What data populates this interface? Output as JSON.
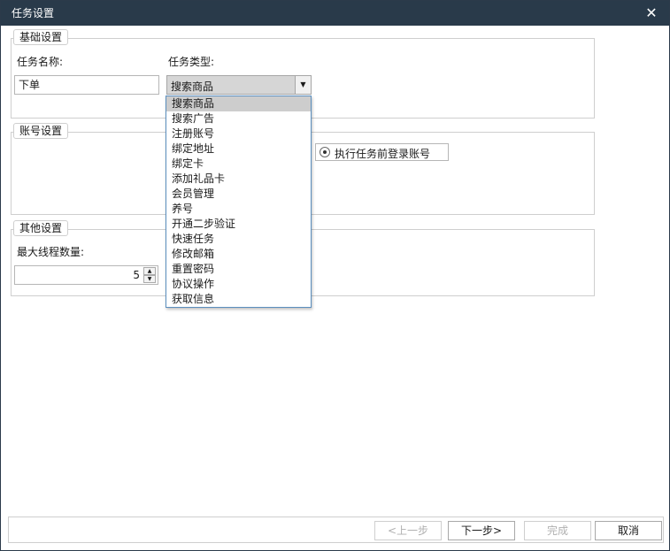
{
  "window": {
    "title": "任务设置"
  },
  "basic": {
    "legend": "基础设置",
    "task_name_label": "任务名称:",
    "task_name_value": "下单",
    "task_type_label": "任务类型:",
    "task_type_value": "搜索商品",
    "task_type_options": [
      "搜索商品",
      "搜索广告",
      "注册账号",
      "绑定地址",
      "绑定卡",
      "添加礼品卡",
      "会员管理",
      "养号",
      "开通二步验证",
      "快速任务",
      "修改邮箱",
      "重置密码",
      "协议操作",
      "获取信息"
    ],
    "selected_index": 0
  },
  "account": {
    "legend": "账号设置",
    "login_option_label": "执行任务前登录账号",
    "login_option_checked": true
  },
  "other": {
    "legend": "其他设置",
    "max_threads_label": "最大线程数量:",
    "max_threads_value": "5"
  },
  "footer": {
    "prev_label": "<上一步",
    "next_label": "下一步>",
    "finish_label": "完成",
    "cancel_label": "取消"
  },
  "colors": {
    "titlebar": "#293a4a",
    "dropdown_border": "#5b8fbf",
    "selected_option": "#cdcdcd"
  },
  "icons": {
    "close": "close-icon",
    "dropdown_arrow": "chevron-down-icon"
  }
}
